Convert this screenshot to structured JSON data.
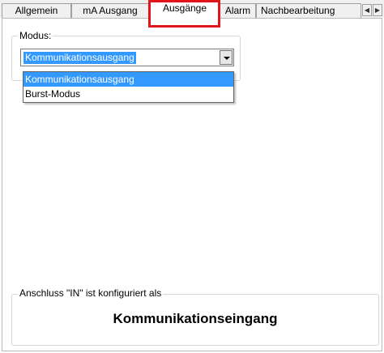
{
  "tabs": [
    {
      "label": "Allgemein",
      "active": false
    },
    {
      "label": "mA Ausgang",
      "active": false
    },
    {
      "label": "Ausgänge",
      "active": true
    },
    {
      "label": "Alarm",
      "active": false
    },
    {
      "label": "Nachbearbeitung",
      "active": false
    }
  ],
  "tab_scroll": {
    "left": "◀",
    "right": "▶"
  },
  "highlight_color": "#e0151b",
  "mode_group": {
    "legend": "Modus:",
    "selected": "Kommunikationsausgang",
    "options": [
      "Kommunikationsausgang",
      "Burst-Modus"
    ]
  },
  "connection_group": {
    "legend": "Anschluss \"IN\" ist konfiguriert als",
    "value": "Kommunikationseingang"
  },
  "colors": {
    "selection": "#3399ff",
    "tab_background": "#f0f0f0"
  }
}
